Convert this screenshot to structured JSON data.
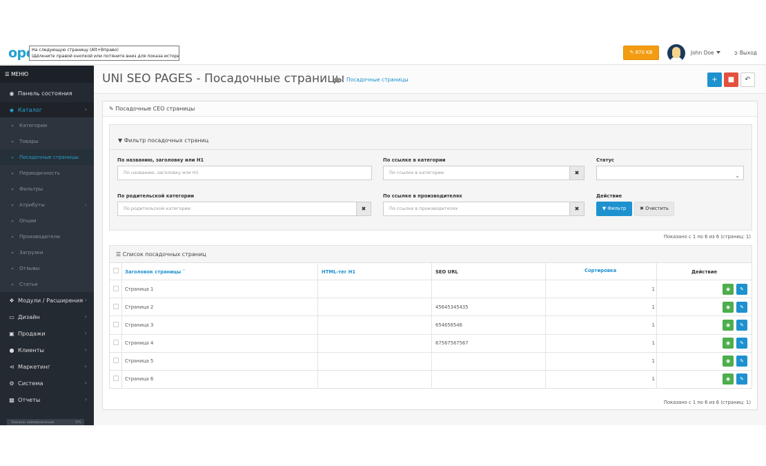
{
  "header": {
    "logo_text": "ope",
    "tooltip_line1": "На следующую страницу (Alt+Вправо)",
    "tooltip_line2": "Щёлкните правой кнопкой или потяните вниз для показа истории",
    "kb_label": "870 KB",
    "user_name": "John Doe",
    "logout_label": "Выход"
  },
  "sidebar": {
    "menu_title": "МЕНЮ",
    "dashboard": "Панель состояния",
    "catalog": "Каталог",
    "catalog_items": [
      "Категории",
      "Товары",
      "Посадочные страницы",
      "Периодичность",
      "Фильтры",
      "Атрибуты",
      "Опции",
      "Производители",
      "Загрузки",
      "Отзывы",
      "Статьи"
    ],
    "modules": "Модули / Расширения",
    "design": "Дизайн",
    "sales": "Продажи",
    "customers": "Клиенты",
    "marketing": "Маркетинг",
    "system": "Система",
    "reports": "Отчеты",
    "progress_label": "Заказы завершенные",
    "progress_value": "0%"
  },
  "page": {
    "title": "UNI SEO PAGES - Посадочные страницы",
    "breadcrumb": "Посадочные страницы"
  },
  "panel": {
    "heading": "Посадочные СЕО страницы"
  },
  "filter": {
    "heading": "Фильтр посадочных страниц",
    "name_label": "По названию, заголовку или H1",
    "name_placeholder": "По названию, заголовку или H1",
    "category_link_label": "По ссылке в категории",
    "category_link_placeholder": "По ссылке в категории",
    "status_label": "Статус",
    "status_value": "",
    "parent_label": "По родительской категории",
    "parent_placeholder": "По родительской категории",
    "manufacturer_label": "По ссылке в производителях",
    "manufacturer_placeholder": "По ссылке в производителях",
    "action_label": "Действие",
    "filter_button": "Фильтр",
    "clear_button": "Очистить"
  },
  "list": {
    "pagination_info": "Показано с 1 по 6 из 6 (страниц: 1)",
    "heading": "Список посадочных страниц",
    "columns": {
      "title": "Заголовок страницы",
      "h1": "HTML-тег H1",
      "seo_url": "SEO URL",
      "sort": "Сортировка",
      "action": "Действие"
    },
    "rows": [
      {
        "title": "Страница 1",
        "h1": "",
        "seo_url": "",
        "sort": "1"
      },
      {
        "title": "Страница 2",
        "h1": "",
        "seo_url": "45645345435",
        "sort": "1"
      },
      {
        "title": "Страница 3",
        "h1": "",
        "seo_url": "654656546",
        "sort": "1"
      },
      {
        "title": "Страница 4",
        "h1": "",
        "seo_url": "67567567567",
        "sort": "1"
      },
      {
        "title": "Страница 5",
        "h1": "",
        "seo_url": "",
        "sort": "1"
      },
      {
        "title": "Страница 6",
        "h1": "",
        "seo_url": "",
        "sort": "1"
      }
    ]
  },
  "colors": {
    "primary": "#1e91cf",
    "danger": "#e3503e",
    "success": "#4cae4c",
    "warning": "#f39c12",
    "sidebar": "#242a32"
  }
}
